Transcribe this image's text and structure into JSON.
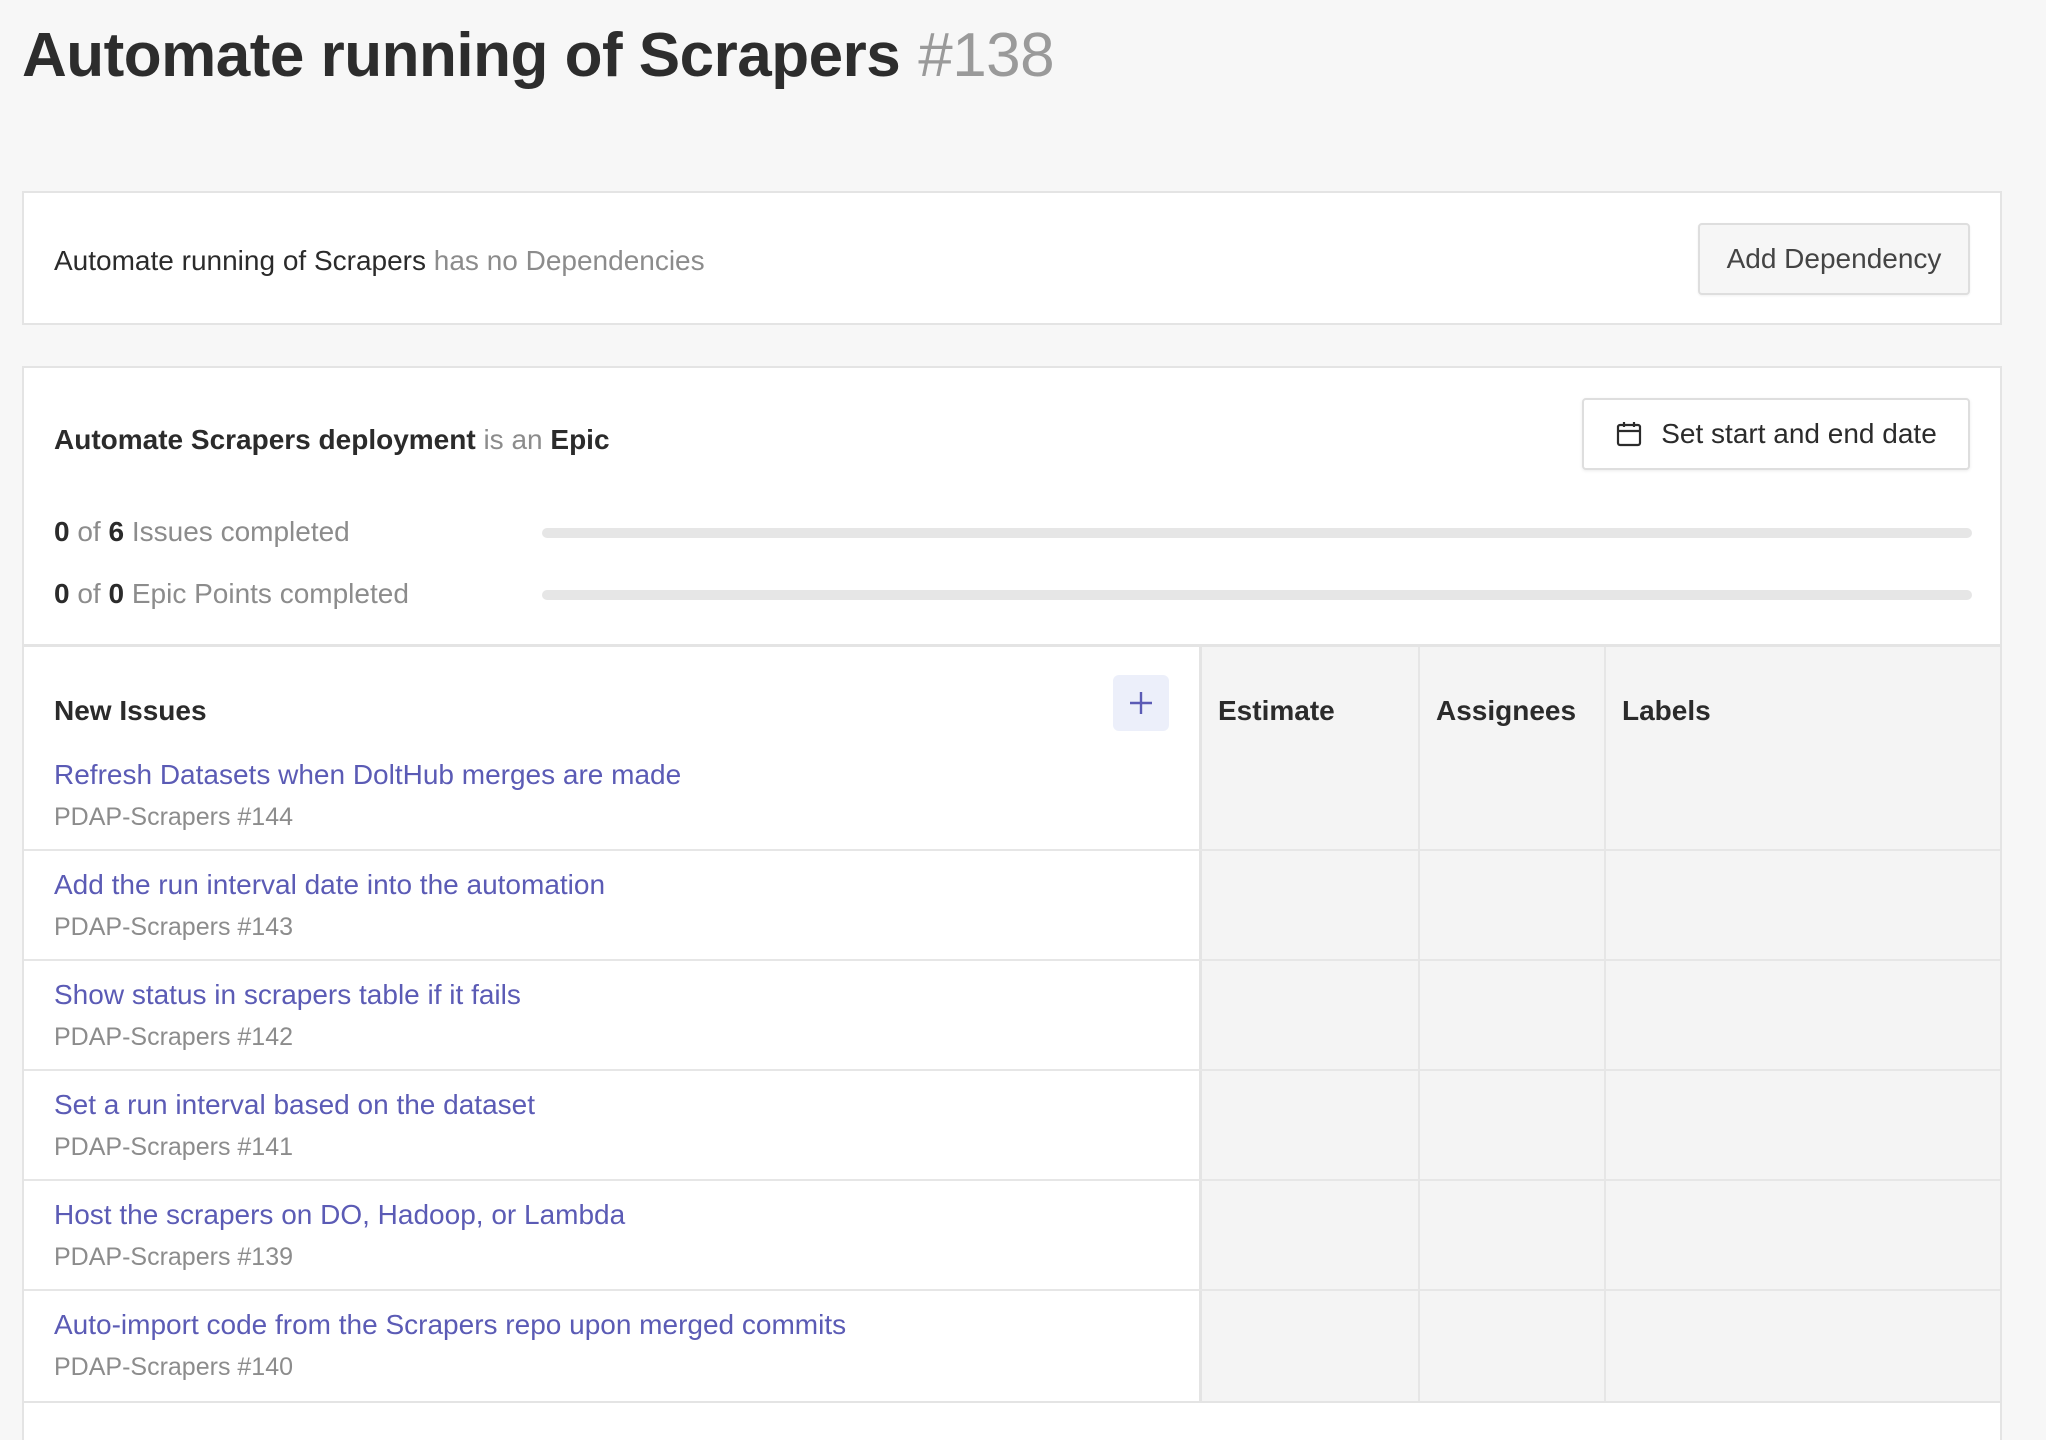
{
  "header": {
    "title": "Automate running of Scrapers",
    "number": "#138"
  },
  "dependencies": {
    "issue_name": "Automate running of Scrapers",
    "status_text": "has no Dependencies",
    "add_button_label": "Add Dependency"
  },
  "epic": {
    "name": "Automate Scrapers deployment",
    "is_an_text": "is an",
    "type_label": "Epic",
    "date_button_label": "Set start and end date",
    "date_icon": "calendar-icon",
    "issues_progress": {
      "completed": "0",
      "of_text": "of",
      "total": "6",
      "label": "Issues completed",
      "fraction": 0
    },
    "points_progress": {
      "completed": "0",
      "of_text": "of",
      "total": "0",
      "label": "Epic Points completed",
      "fraction": 0
    },
    "progress_color": "#6a6ab8"
  },
  "issues_table": {
    "section_label": "New Issues",
    "add_icon": "plus-icon",
    "columns": {
      "estimate": "Estimate",
      "assignees": "Assignees",
      "labels": "Labels"
    },
    "issues": [
      {
        "title": "Refresh Datasets when DoltHub merges are made",
        "ref": "PDAP-Scrapers #144"
      },
      {
        "title": "Add the run interval date into the automation",
        "ref": "PDAP-Scrapers #143"
      },
      {
        "title": "Show status in scrapers table if it fails",
        "ref": "PDAP-Scrapers #142"
      },
      {
        "title": "Set a run interval based on the dataset",
        "ref": "PDAP-Scrapers #141"
      },
      {
        "title": "Host the scrapers on DO, Hadoop, or Lambda",
        "ref": "PDAP-Scrapers #139"
      },
      {
        "title": "Auto-import code from the Scrapers repo upon merged commits",
        "ref": "PDAP-Scrapers #140"
      }
    ]
  },
  "colors": {
    "link": "#5b5bb5",
    "muted": "#8c8c8c",
    "background": "#f7f7f7"
  }
}
